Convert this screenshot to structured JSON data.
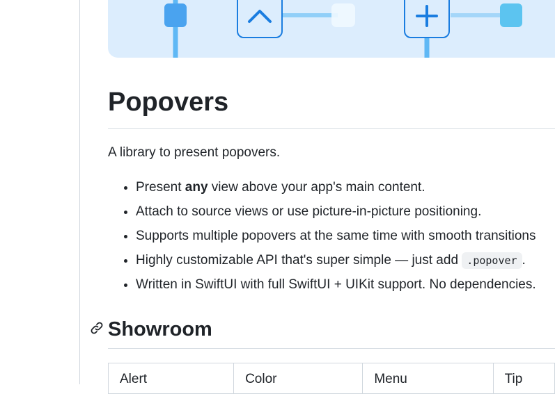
{
  "colors": {
    "accent": "#4aa3ef",
    "banner_bg": "#dcedfd",
    "border": "#d0d7de"
  },
  "banner": {
    "icons": [
      "chevron-up-icon",
      "plus-icon"
    ]
  },
  "heading": "Popovers",
  "intro": "A library to present popovers.",
  "features": [
    {
      "prefix": "Present ",
      "bold": "any",
      "suffix": " view above your app's main content."
    },
    {
      "text": "Attach to source views or use picture-in-picture positioning."
    },
    {
      "text": "Supports multiple popovers at the same time with smooth transitions"
    },
    {
      "prefix": "Highly customizable API that's super simple — just add ",
      "code": ".popover",
      "suffix": "."
    },
    {
      "text": "Written in SwiftUI with full SwiftUI + UIKit support. No dependencies."
    }
  ],
  "showroom": {
    "heading": "Showroom",
    "columns": [
      "Alert",
      "Color",
      "Menu",
      "Tip"
    ]
  }
}
